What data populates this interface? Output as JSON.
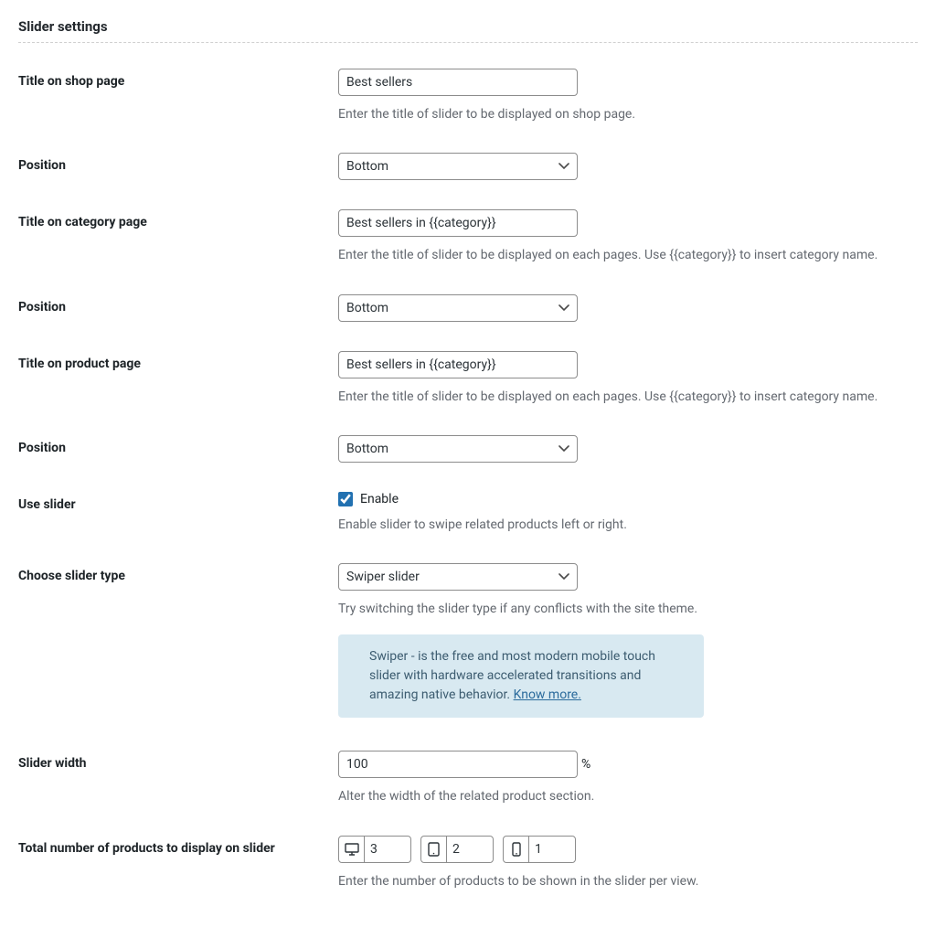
{
  "section_title": "Slider settings",
  "title_shop": {
    "label": "Title on shop page",
    "value": "Best sellers",
    "desc": "Enter the title of slider to be displayed on shop page."
  },
  "position1": {
    "label": "Position",
    "value": "Bottom"
  },
  "title_category": {
    "label": "Title on category page",
    "value": "Best sellers in {{category}}",
    "desc": "Enter the title of slider to be displayed on each pages. Use {{category}} to insert category name."
  },
  "position2": {
    "label": "Position",
    "value": "Bottom"
  },
  "title_product": {
    "label": "Title on product page",
    "value": "Best sellers in {{category}}",
    "desc": "Enter the title of slider to be displayed on each pages. Use {{category}} to insert category name."
  },
  "position3": {
    "label": "Position",
    "value": "Bottom"
  },
  "use_slider": {
    "label": "Use slider",
    "checkbox_label": "Enable",
    "checked": true,
    "desc": "Enable slider to swipe related products left or right."
  },
  "slider_type": {
    "label": "Choose slider type",
    "value": "Swiper slider",
    "desc": "Try switching the slider type if any conflicts with the site theme."
  },
  "notice": {
    "text": "Swiper - is the free and most modern mobile touch slider with hardware accelerated transitions and amazing native behavior. ",
    "link_text": "Know more."
  },
  "slider_width": {
    "label": "Slider width",
    "value": "100",
    "unit": "%",
    "desc": "Alter the width of the related product section."
  },
  "products_count": {
    "label": "Total number of products to display on slider",
    "desktop": "3",
    "tablet": "2",
    "mobile": "1",
    "desc": "Enter the number of products to be shown in the slider per view."
  }
}
